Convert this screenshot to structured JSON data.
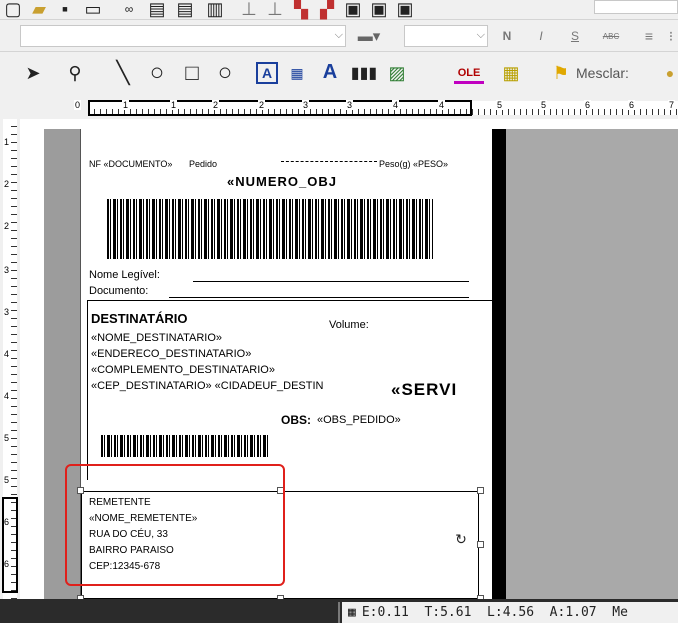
{
  "toolbar": {
    "mesclar_label": "Mesclar:",
    "bold_label": "N",
    "italic_label": "I",
    "underline_label": "S",
    "strike_label": "ABC",
    "text_tool_label": "A",
    "ole_label": "OLE"
  },
  "rulers": {
    "top_numbers": [
      "0",
      "1",
      "1",
      "2",
      "2",
      "3",
      "3",
      "4",
      "4",
      "5",
      "5",
      "6",
      "6",
      "7"
    ],
    "left_numbers": [
      "1",
      "2",
      "2",
      "3",
      "3",
      "4",
      "4",
      "5",
      "5",
      "6",
      "6"
    ]
  },
  "label": {
    "nf_documento": "NF «DOCUMENTO»",
    "pedido": "Pedido",
    "peso": "Peso(g) «PESO»",
    "numero_obj": "«NUMERO_OBJ",
    "nome_legivel": "Nome Legível:",
    "documento": "Documento:",
    "destinatario_title": "DESTINATÁRIO",
    "volume": "Volume:",
    "nome_destinatario": "«NOME_DESTINATARIO»",
    "endereco_destinatario": "«ENDERECO_DESTINATARIO»",
    "complemento_destinatario": "«COMPLEMENTO_DESTINATARIO»",
    "cep_cidade": "«CEP_DESTINATARIO» «CIDADEUF_DESTIN",
    "servico": "«SERVI",
    "obs_label": "OBS:",
    "obs_value": "«OBS_PEDIDO»",
    "remetente_title": "REMETENTE",
    "nome_remetente": "«NOME_REMETENTE»",
    "rua": "RUA DO CÉU, 33",
    "bairro": "BAIRRO PARAISO",
    "cep": "CEP:12345-678"
  },
  "status": {
    "text": "E:0.11  T:5.61  L:4.56  A:1.07  Me"
  },
  "colors": {
    "highlight_frame": "#e0201b",
    "toolbar_bg": "#f0f0f0",
    "dark_bg": "#2b2b2b"
  },
  "icons": [
    "pointer-icon",
    "zoom-icon",
    "line-icon",
    "ellipse-icon",
    "rectangle-icon",
    "circle-icon",
    "text-frame-icon",
    "memo-icon",
    "text-icon",
    "barcode-icon",
    "image-icon",
    "ole-icon",
    "grid-icon",
    "merge-icon",
    "rotate-icon",
    "grid-status-icon"
  ]
}
